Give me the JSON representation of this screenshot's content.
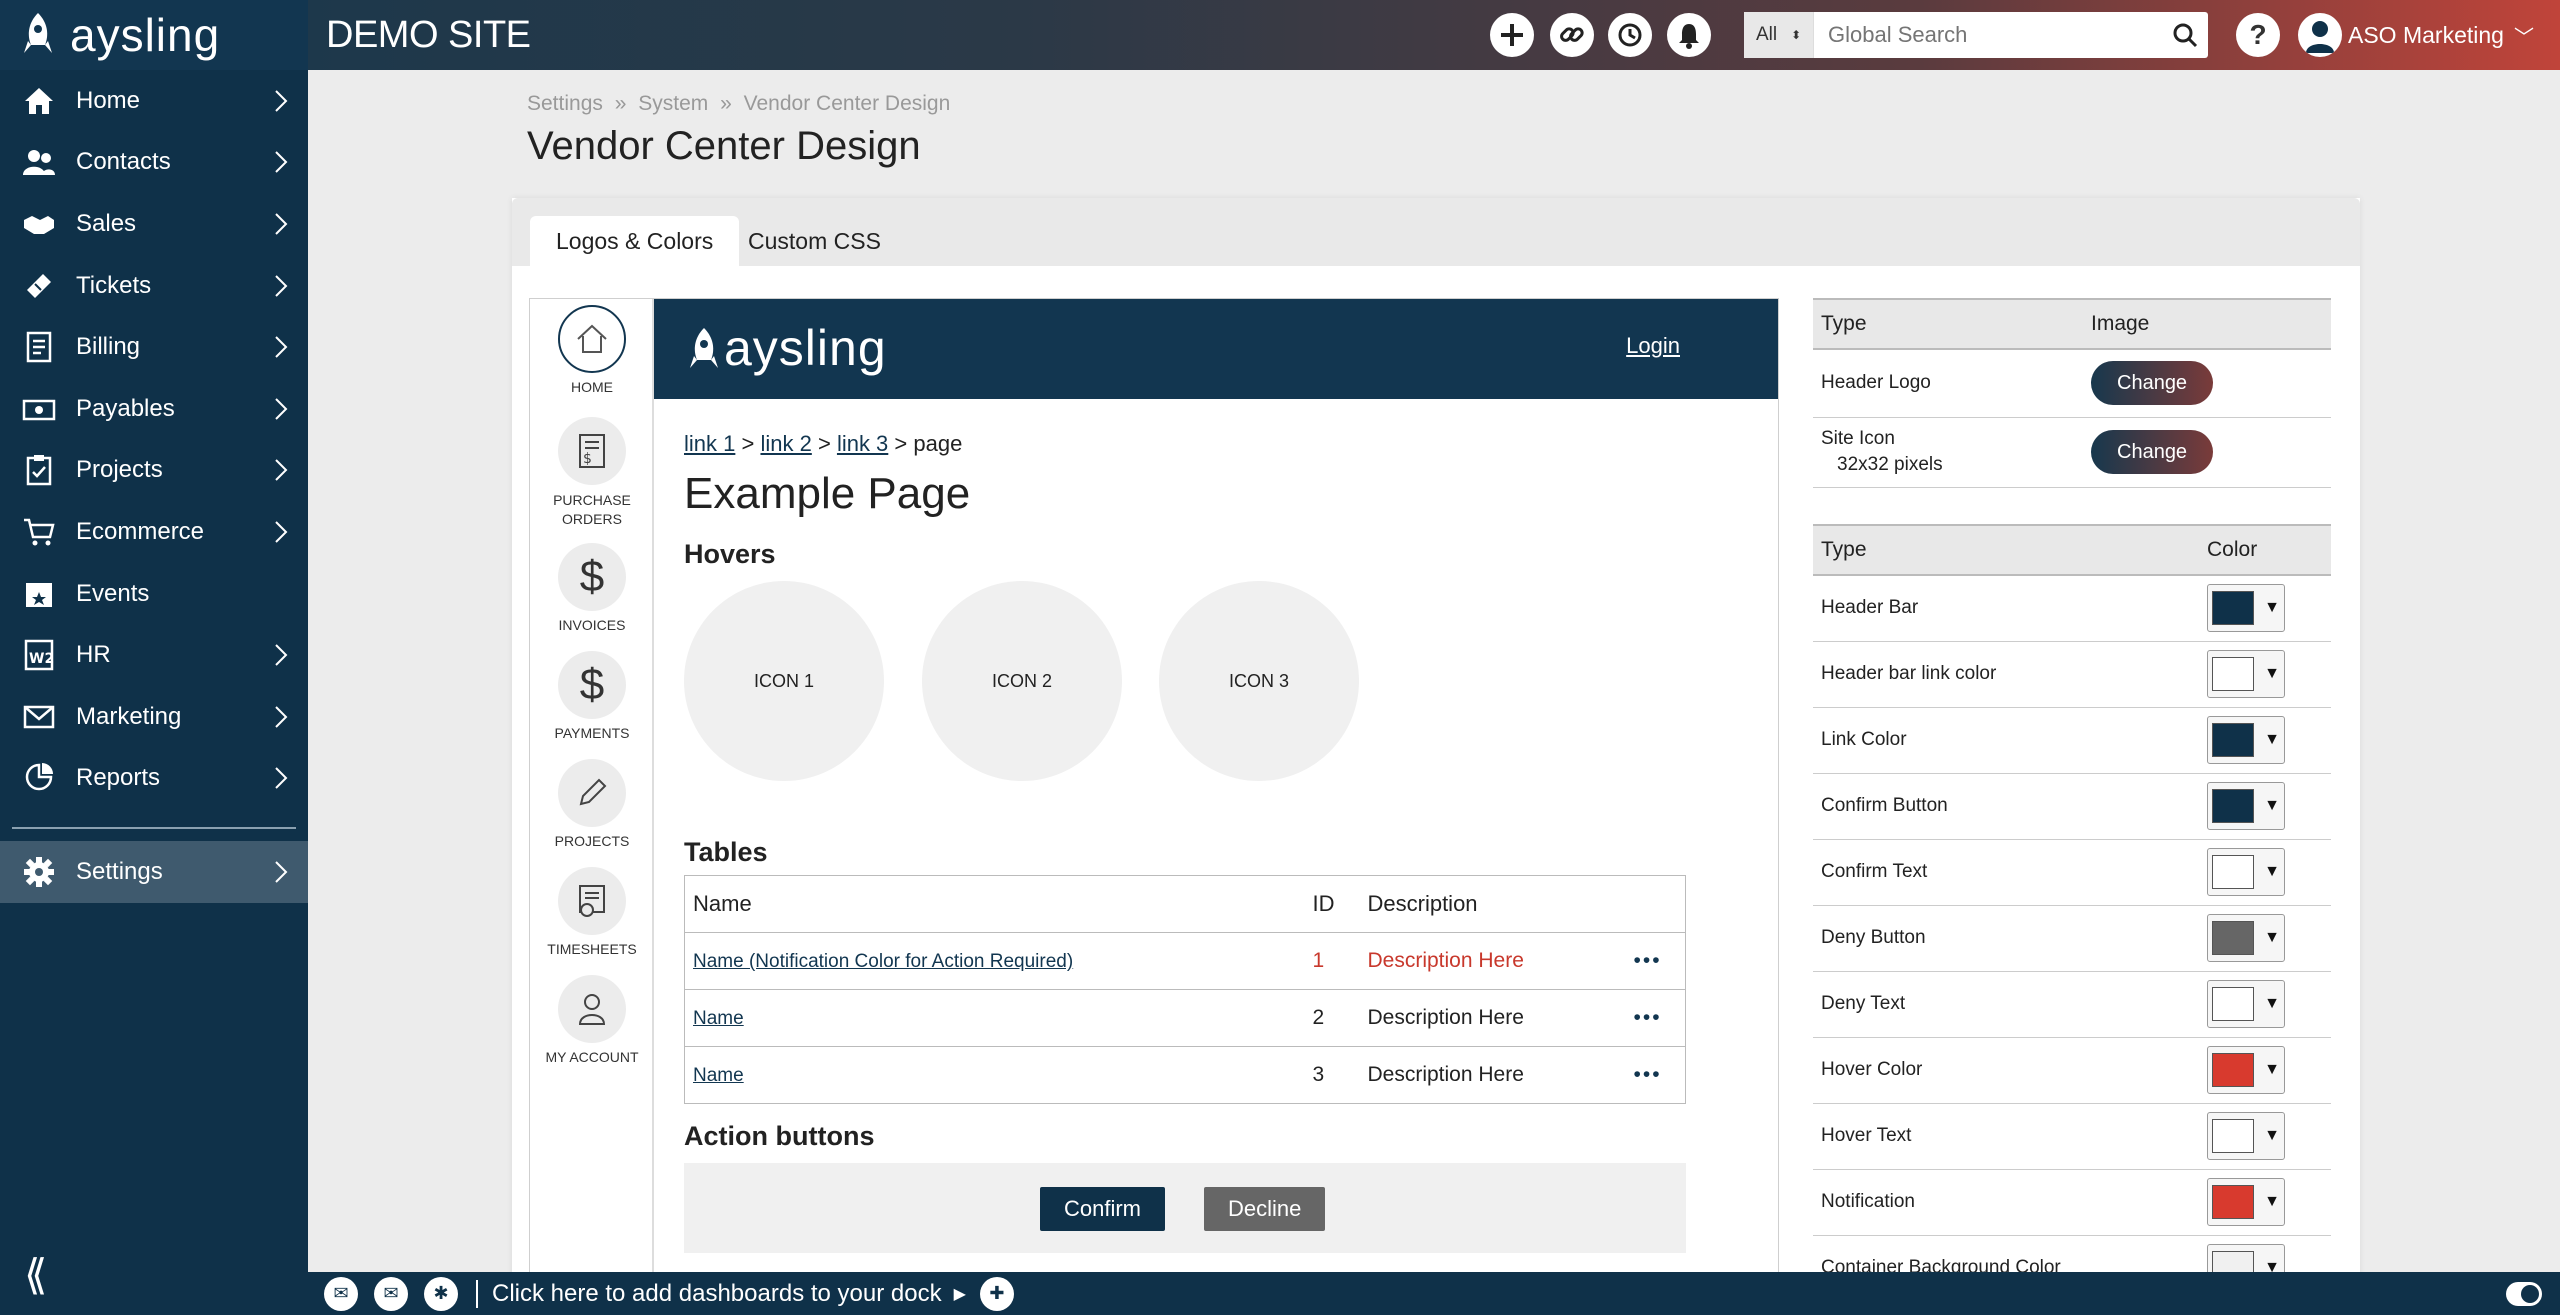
{
  "brand": {
    "name": "aysling"
  },
  "site_title": "DEMO SITE",
  "search": {
    "scope": "All",
    "placeholder": "Global Search"
  },
  "user": {
    "name": "ASO Marketing"
  },
  "sidebar": {
    "items": [
      {
        "label": "Home",
        "icon": "home-icon",
        "chevron": true
      },
      {
        "label": "Contacts",
        "icon": "contacts-icon",
        "chevron": true
      },
      {
        "label": "Sales",
        "icon": "handshake-icon",
        "chevron": true
      },
      {
        "label": "Tickets",
        "icon": "ticket-icon",
        "chevron": true
      },
      {
        "label": "Billing",
        "icon": "billing-icon",
        "chevron": true
      },
      {
        "label": "Payables",
        "icon": "payables-icon",
        "chevron": true
      },
      {
        "label": "Projects",
        "icon": "clipboard-icon",
        "chevron": true
      },
      {
        "label": "Ecommerce",
        "icon": "cart-icon",
        "chevron": true
      },
      {
        "label": "Events",
        "icon": "calendar-icon",
        "chevron": false
      },
      {
        "label": "HR",
        "icon": "w2-icon",
        "chevron": true
      },
      {
        "label": "Marketing",
        "icon": "mail-icon",
        "chevron": true
      },
      {
        "label": "Reports",
        "icon": "reports-icon",
        "chevron": true
      }
    ],
    "settings": {
      "label": "Settings",
      "icon": "gear-icon"
    }
  },
  "breadcrumb": [
    "Settings",
    "»",
    "System",
    "»",
    "Vendor Center Design"
  ],
  "page_title": "Vendor Center Design",
  "tabs": [
    {
      "label": "Logos & Colors",
      "active": true
    },
    {
      "label": "Custom CSS",
      "active": false
    }
  ],
  "preview": {
    "side_nav": [
      {
        "label": "HOME",
        "icon": "home-icon"
      },
      {
        "label": "PURCHASE ORDERS",
        "icon": "purchase-order-icon"
      },
      {
        "label": "INVOICES",
        "icon": "dollar-icon"
      },
      {
        "label": "PAYMENTS",
        "icon": "dollar-icon"
      },
      {
        "label": "PROJECTS",
        "icon": "pencil-icon"
      },
      {
        "label": "TIMESHEETS",
        "icon": "timesheet-icon"
      },
      {
        "label": "MY ACCOUNT",
        "icon": "user-icon"
      }
    ],
    "logo": "aysling",
    "login": "Login",
    "crumbs": {
      "link1": "link 1",
      "link2": "link 2",
      "link3": "link 3",
      "sep": ">",
      "page": "page"
    },
    "title": "Example Page",
    "hovers_heading": "Hovers",
    "hover_icons": [
      "ICON 1",
      "ICON 2",
      "ICON 3"
    ],
    "tables_heading": "Tables",
    "table": {
      "headers": [
        "Name",
        "ID",
        "Description"
      ],
      "rows": [
        {
          "name": "Name (Notification Color for Action Required)",
          "id": "1",
          "description": "Description Here",
          "alert": true
        },
        {
          "name": "Name",
          "id": "2",
          "description": "Description Here",
          "alert": false
        },
        {
          "name": "Name",
          "id": "3",
          "description": "Description Here",
          "alert": false
        }
      ],
      "more": "•••"
    },
    "actions_heading": "Action buttons",
    "confirm_label": "Confirm",
    "decline_label": "Decline"
  },
  "logo_table": {
    "headers": [
      "Type",
      "Image"
    ],
    "rows": [
      {
        "type": "Header Logo",
        "sub": "",
        "button": "Change"
      },
      {
        "type": "Site Icon",
        "sub": "32x32 pixels",
        "button": "Change"
      }
    ]
  },
  "color_table": {
    "headers": [
      "Type",
      "Color"
    ],
    "rows": [
      {
        "type": "Header Bar",
        "color": "#0f3149"
      },
      {
        "type": "Header bar link color",
        "color": "#ffffff"
      },
      {
        "type": "Link Color",
        "color": "#0f3149"
      },
      {
        "type": "Confirm Button",
        "color": "#0f3149"
      },
      {
        "type": "Confirm Text",
        "color": "#ffffff"
      },
      {
        "type": "Deny Button",
        "color": "#666666"
      },
      {
        "type": "Deny Text",
        "color": "#ffffff"
      },
      {
        "type": "Hover Color",
        "color": "#d83a2e"
      },
      {
        "type": "Hover Text",
        "color": "#ffffff"
      },
      {
        "type": "Notification",
        "color": "#d83a2e"
      },
      {
        "type": "Container Background Color",
        "color": "#f0f0f0"
      }
    ]
  },
  "dock": {
    "text": "Click here to add dashboards to your dock"
  },
  "colors": {
    "navy": "#0f3149",
    "accent_red": "#c0443a",
    "deny_gray": "#666666"
  }
}
